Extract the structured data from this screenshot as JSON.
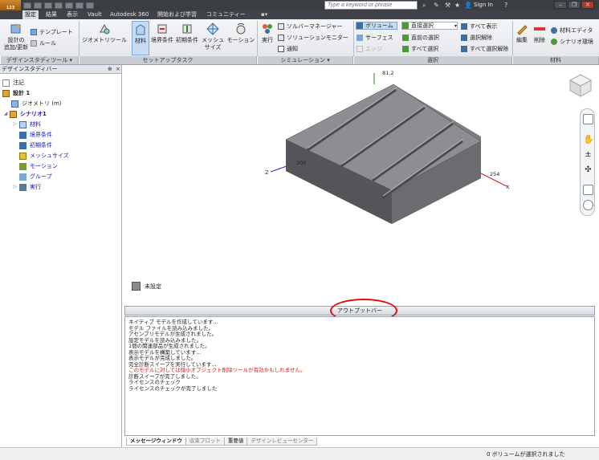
{
  "titlebar": {
    "app_button": "123",
    "search_placeholder": "Type a keyword or phrase",
    "sign_in": "Sign In",
    "help": "?"
  },
  "tabs": [
    "設定",
    "結果",
    "表示",
    "Vault",
    "Autodesk 360",
    "開始および学習",
    "コミュニティー"
  ],
  "ribbon": {
    "panels": [
      {
        "title": "デザインスタディツール ▾"
      },
      {
        "title": "セットアップタスク"
      },
      {
        "title": "シミュレーション ▾"
      },
      {
        "title": "選択"
      },
      {
        "title": "材料"
      }
    ],
    "design_tools": {
      "add_update": "設計の\n追加/更新",
      "template": "テンプレート",
      "rule": "ルール"
    },
    "setup": {
      "geometry_tool": "ジオメトリツール",
      "material": "材料",
      "boundary": "境界条件",
      "initial": "初期条件",
      "mesh": "メッシュ\nサイズ",
      "motion": "モーション"
    },
    "simulation": {
      "run": "実行",
      "solver_manager": "ソルバーマネージャー",
      "solution_monitor": "ソリューションモニター",
      "notify": "通知"
    },
    "selection": {
      "volume": "ボリューム",
      "surface": "サーフェス",
      "edge": "エッジ",
      "direct_select": "直接選択",
      "prev_select": "直前の選択",
      "select_all": "すべて選択",
      "show_all": "すべて表示",
      "deselect": "選択解除",
      "deselect_all": "すべて選択解除"
    },
    "material": {
      "edit": "編集",
      "delete": "削除",
      "material_editor": "材料エディタ",
      "scenario_env": "シナリオ環境"
    }
  },
  "browser": {
    "title": "デザインスタディバー",
    "pin": "⊕",
    "close": "×",
    "items": [
      {
        "label": "注記"
      },
      {
        "label": "設計 1"
      },
      {
        "label": "ジオメトリ (m)"
      },
      {
        "label": "シナリオ1"
      },
      {
        "label": "材料"
      },
      {
        "label": "境界条件"
      },
      {
        "label": "初期条件"
      },
      {
        "label": "メッシュサイズ"
      },
      {
        "label": "モーション"
      },
      {
        "label": "グループ"
      },
      {
        "label": "実行"
      }
    ]
  },
  "viewport": {
    "triad": {
      "y_value": "81.2",
      "z_value": "200",
      "x_value": "254",
      "x_label": "X",
      "z_label": "Z"
    },
    "legend": "未設定"
  },
  "output": {
    "header": "アウトプットバー",
    "lines": [
      {
        "text": "ネイティブ モデルを作成しています...",
        "error": false
      },
      {
        "text": "モデル ファイルを読み込みました。",
        "error": false
      },
      {
        "text": "アセンブリモデルが生成されました。",
        "error": false
      },
      {
        "text": "設定モデルを読み込みました。",
        "error": false
      },
      {
        "text": "1個の関連部品が生成されました。",
        "error": false
      },
      {
        "text": "表示モデルを構築しています...",
        "error": false
      },
      {
        "text": "表示モデルが完成しました。",
        "error": false
      },
      {
        "text": "完全診断スイープを実行しています...",
        "error": false
      },
      {
        "text": "このモデルに対しては微小オブジェクト削除ツールが有効かもしれません。",
        "error": true
      },
      {
        "text": "診断スイープが完了しました。",
        "error": false
      },
      {
        "text": "ライセンスのチェック",
        "error": false
      },
      {
        "text": "ライセンスのチェックが完了しました",
        "error": false
      }
    ],
    "tabs": [
      "メッセージウィンドウ",
      "収束プロット",
      "重要値",
      "デザインレビューセンター"
    ]
  },
  "status": {
    "text": "0 ボリュームが選択されました"
  },
  "colors": {
    "accent": "#d08a2c",
    "annotation": "#e01010",
    "error_text": "#d01a1a",
    "tree_blue": "#1515c8"
  }
}
